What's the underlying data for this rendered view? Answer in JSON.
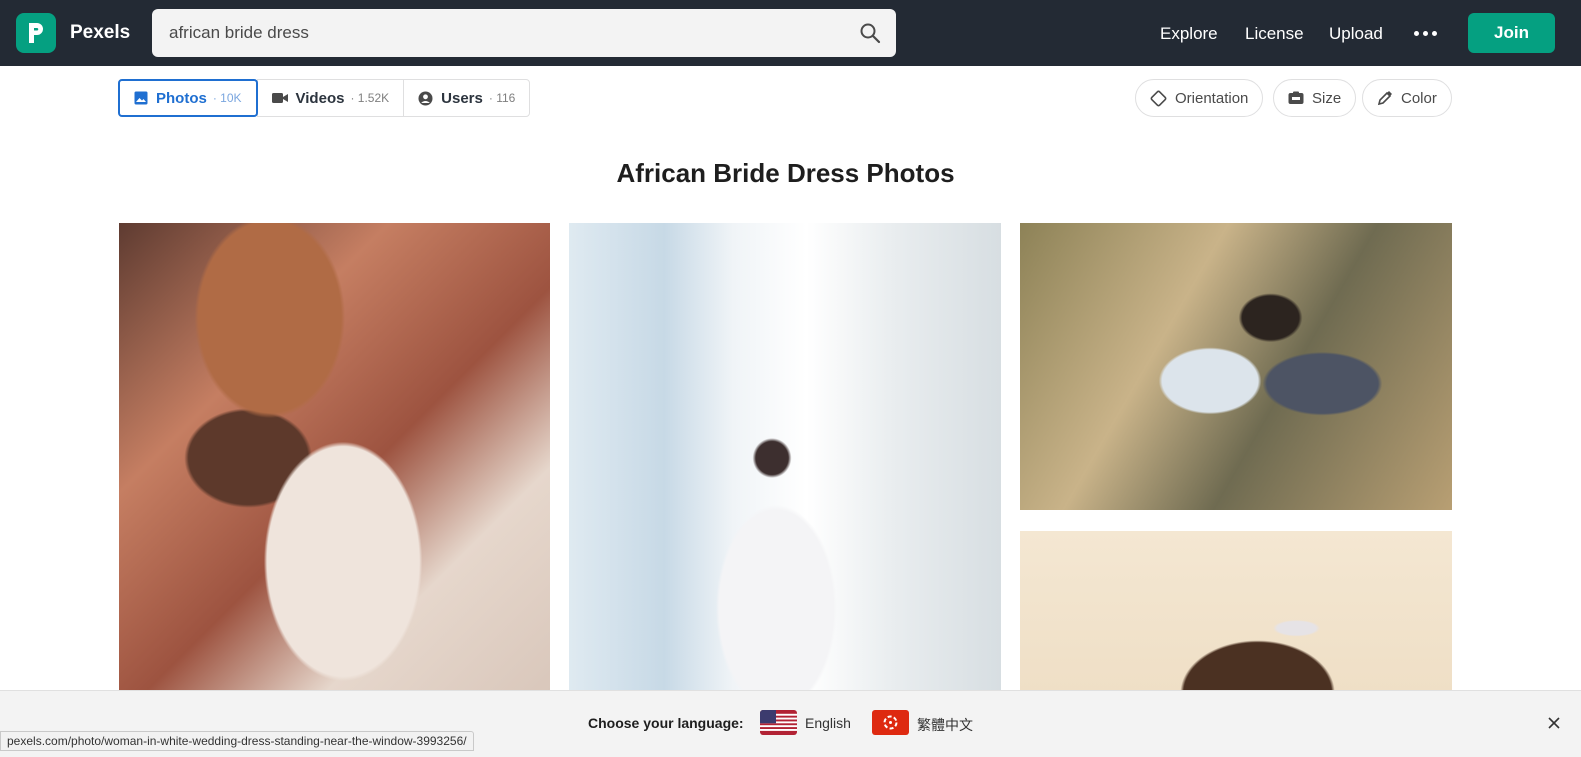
{
  "header": {
    "brand": "Pexels",
    "search_value": "african bride dress",
    "nav": [
      "Explore",
      "License",
      "Upload"
    ],
    "join_label": "Join",
    "accent": "#05a081"
  },
  "tabs": [
    {
      "label": "Photos",
      "count": "· 10K",
      "icon": "image-icon",
      "active": true
    },
    {
      "label": "Videos",
      "count": "· 1.52K",
      "icon": "video-camera-icon",
      "active": false
    },
    {
      "label": "Users",
      "count": "· 116",
      "icon": "user-circle-icon",
      "active": false
    }
  ],
  "filters": [
    "Orientation",
    "Size",
    "Color"
  ],
  "page_title": "African Bride Dress Photos",
  "language_bar": {
    "prompt": "Choose your language:",
    "options": [
      "English",
      "繁體中文"
    ]
  },
  "status_url": "pexels.com/photo/woman-in-white-wedding-dress-standing-near-the-window-3993256/"
}
